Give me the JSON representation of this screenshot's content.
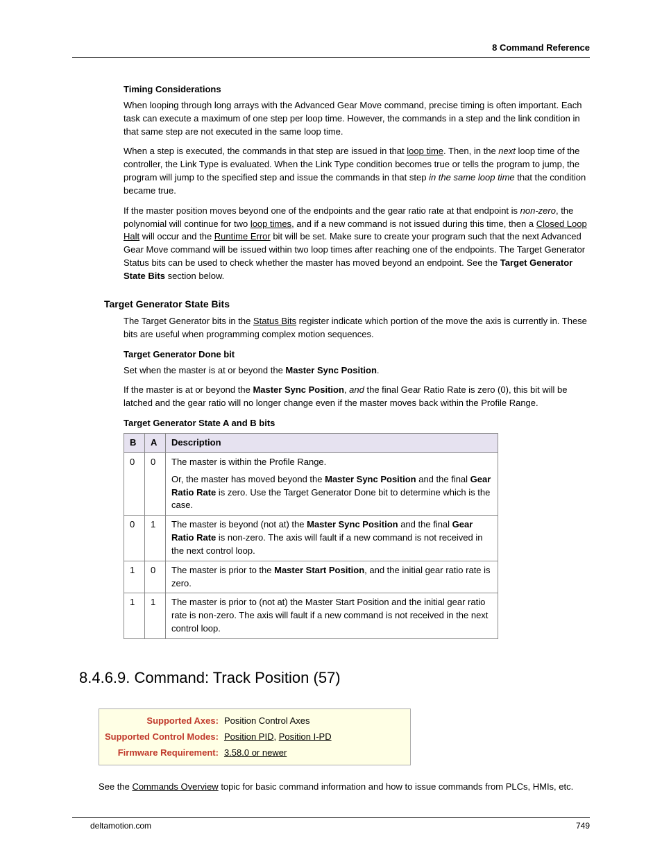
{
  "header": {
    "right": "8  Command Reference"
  },
  "timing": {
    "heading": "Timing Considerations",
    "p1": "When looping through long arrays with the Advanced Gear Move command, precise timing is often important. Each task can execute a maximum of one step per loop time. However, the commands in a step and the link condition in that same step are not executed in the same loop time.",
    "p2a": "When a step is executed, the commands in that step are issued in that ",
    "p2_loop": "loop time",
    "p2b": ". Then, in the ",
    "p2_next": "next",
    "p2c": " loop time of the controller, the Link Type is evaluated. When the Link Type condition becomes true or tells the program to jump, the program will jump to the specified step and issue the commands in that step ",
    "p2_same": "in the same loop time",
    "p2d": " that the condition became true.",
    "p3a": "If the master position moves beyond one of the endpoints and the gear ratio rate at that endpoint is ",
    "p3_nz": "non-zero",
    "p3b": ", the polynomial will continue for two ",
    "p3_lt": "loop times",
    "p3c": ", and if a new command is not issued during this time, then a ",
    "p3_clh": "Closed Loop Halt",
    "p3d": " will occur and the ",
    "p3_re": "Runtime Error",
    "p3e": " bit will be set. Make sure to create your program such that the next Advanced Gear Move command will be issued within two loop times after reaching one of the endpoints. The Target Generator Status bits can be used to check whether the master has moved beyond an endpoint. See the ",
    "p3_tgsb": "Target Generator State Bits",
    "p3f": " section below."
  },
  "tgsb": {
    "heading": "Target Generator State Bits",
    "p1a": "The Target Generator bits in the ",
    "p1_sb": "Status Bits",
    "p1b": " register indicate which portion of the move the axis is currently in.  These bits are useful when programming complex motion sequences.",
    "done_heading": "Target Generator Done bit",
    "done_p_a": "Set when the master is at or beyond the ",
    "done_p_msp": "Master Sync Position",
    "done_p_b": ".",
    "done_p2_a": "If the master is at or beyond the ",
    "done_p2_msp": "Master Sync Position",
    "done_p2_b": ", ",
    "done_p2_and": "and",
    "done_p2_c": " the final Gear Ratio Rate is zero (0), this bit will be latched and the gear ratio will no longer change even if the master moves back within the Profile Range.",
    "ab_heading": "Target Generator State A and B bits",
    "table": {
      "headers": {
        "b": "B",
        "a": "A",
        "d": "Description"
      },
      "rows": [
        {
          "b": "0",
          "a": "0",
          "d1": "The master is within the Profile Range.",
          "d2a": "Or, the master has moved beyond the ",
          "d2_msp": "Master Sync Position",
          "d2b": " and the final ",
          "d2_grr": "Gear Ratio Rate",
          "d2c": " is zero. Use the Target Generator Done bit to determine which is the case."
        },
        {
          "b": "0",
          "a": "1",
          "d1a": "The master is beyond (not at) the ",
          "d1_msp": "Master Sync Position",
          "d1b": " and the final ",
          "d1_grr": "Gear Ratio Rate",
          "d1c": " is non-zero. The axis will fault if a new command is not received in the next control loop."
        },
        {
          "b": "1",
          "a": "0",
          "d1a": "The master is prior to the ",
          "d1_msp": "Master Start Position",
          "d1b": ", and the initial gear ratio rate is zero."
        },
        {
          "b": "1",
          "a": "1",
          "d1": "The master is prior to (not at) the Master Start Position and the initial gear ratio rate is non-zero. The axis will fault if a new command is not received in the next control loop."
        }
      ]
    }
  },
  "cmd": {
    "heading": "8.4.6.9. Command: Track Position (57)",
    "box": {
      "axes_label": "Supported Axes:",
      "axes_value": "Position Control Axes",
      "modes_label": "Supported Control Modes:",
      "modes_v1": "Position PID",
      "modes_sep": ", ",
      "modes_v2": "Position I-PD",
      "fw_label": "Firmware Requirement:",
      "fw_value": "3.58.0 or newer"
    },
    "p1a": "See the ",
    "p1_link": "Commands Overview",
    "p1b": " topic for basic command information and how to issue commands from PLCs, HMIs, etc."
  },
  "footer": {
    "left": "deltamotion.com",
    "right": "749"
  }
}
